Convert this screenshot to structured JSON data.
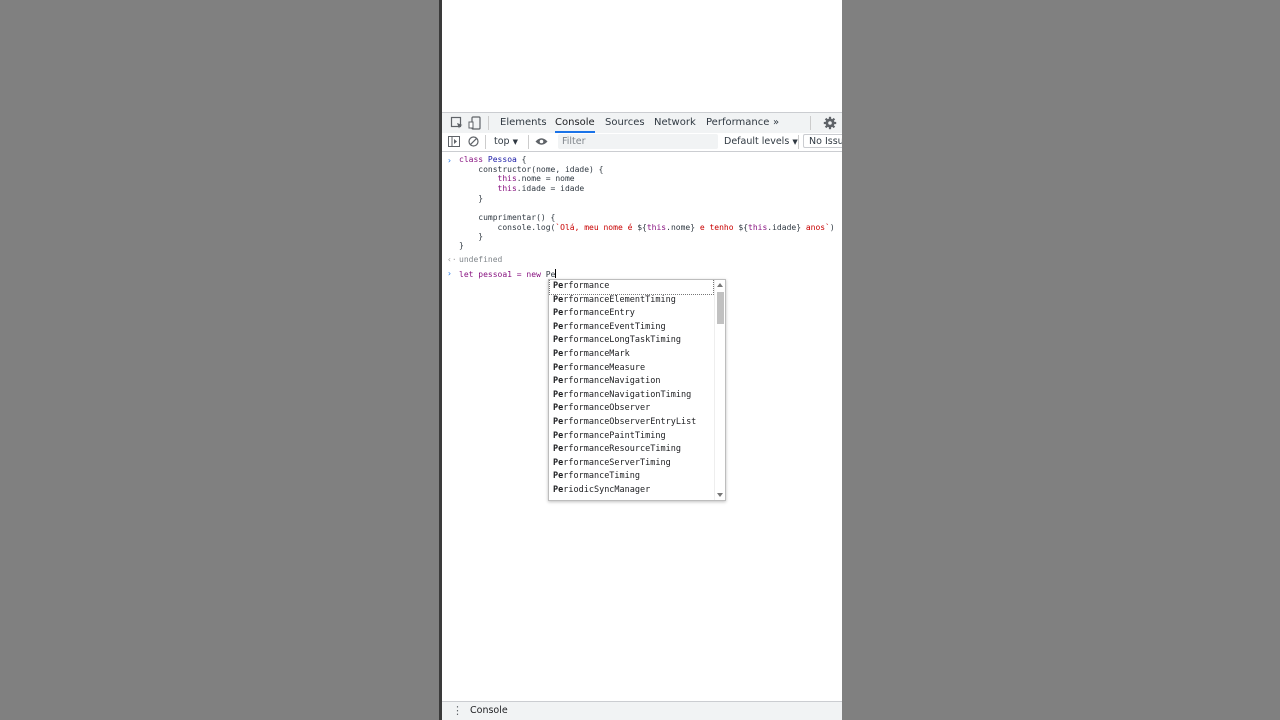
{
  "devtools": {
    "tabs": [
      "Elements",
      "Console",
      "Sources",
      "Network",
      "Performance"
    ],
    "more_tabs": "»",
    "active_tab": "Console"
  },
  "toolbar": {
    "context": "top",
    "filter_placeholder": "Filter",
    "levels": "Default levels",
    "issues": "No Issues"
  },
  "console": {
    "code_lines": [
      "class Pessoa {",
      "    constructor(nome, idade) {",
      "        this.nome = nome",
      "        this.idade = idade",
      "    }",
      "",
      "    cumprimentar() {",
      "        console.log(`Olá, meu nome é ${this.nome} e tenho ${this.idade} anos`)",
      "    }",
      "}"
    ],
    "result": "undefined",
    "input_prefix": "let pessoa1 = new ",
    "input_typed": "Pe"
  },
  "autocomplete": {
    "match": "Pe",
    "items": [
      "rformance",
      "rformanceElementTiming",
      "rformanceEntry",
      "rformanceEventTiming",
      "rformanceLongTaskTiming",
      "rformanceMark",
      "rformanceMeasure",
      "rformanceNavigation",
      "rformanceNavigationTiming",
      "rformanceObserver",
      "rformanceObserverEntryList",
      "rformancePaintTiming",
      "rformanceResourceTiming",
      "rformanceServerTiming",
      "rformanceTiming",
      "riodicSyncManager"
    ]
  },
  "drawer": {
    "label": "Console"
  }
}
